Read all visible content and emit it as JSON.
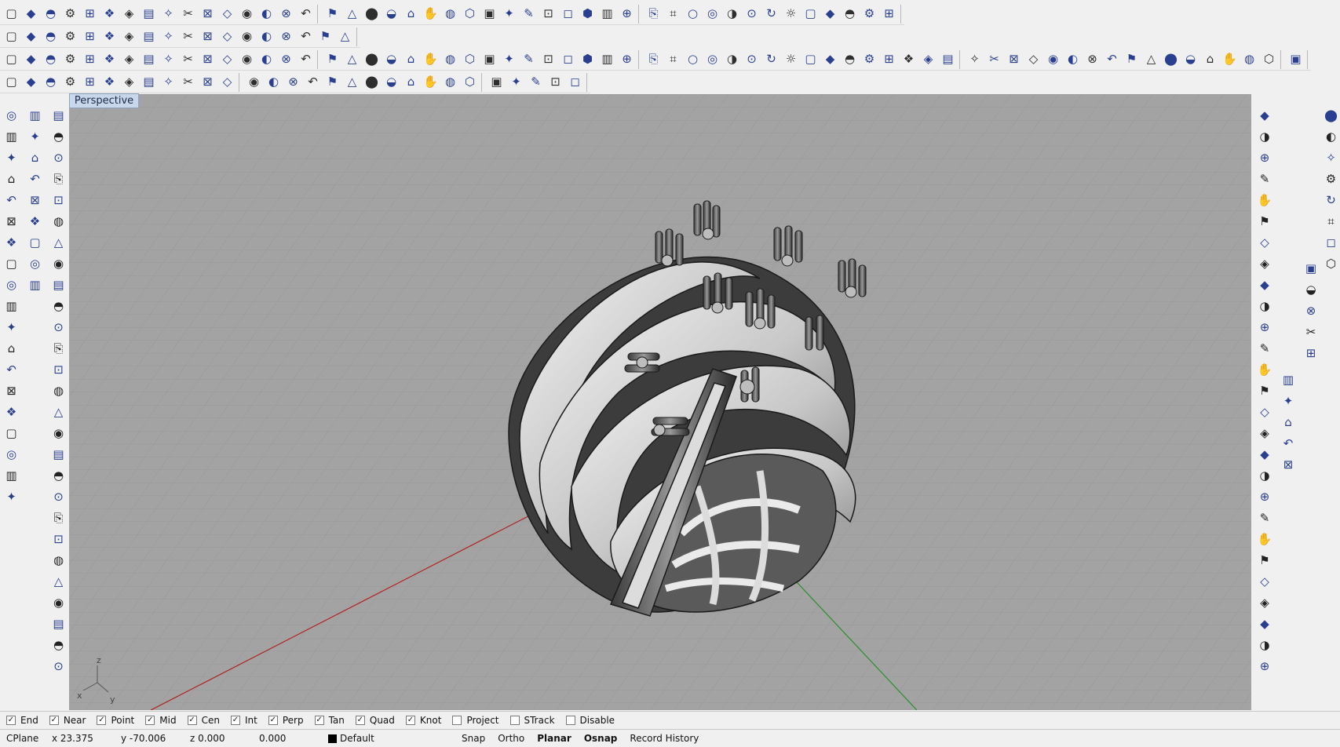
{
  "toolbars": {
    "row1": [
      "new-file",
      "open-file",
      "save-file",
      "print",
      "export",
      "cut",
      "copy",
      "paste",
      "undo",
      "pan",
      "rotate-view",
      "zoom",
      "zoom-window",
      "zoom-extents",
      "zoom-selected",
      "undo-view",
      "four-viewports",
      "car-icon",
      "cplane",
      "orientation",
      "object-snap",
      "bulb",
      "lock",
      "paint",
      "color-wheel",
      "sphere-wire",
      "sphere-grid",
      "sphere-render",
      "flag",
      "gear",
      "setup",
      "help",
      "box",
      "sphere",
      "ellipsoid",
      "paraboloid",
      "cone",
      "pyramid",
      "truncated-cone",
      "cylinder",
      "tube",
      "torus",
      "torus-half",
      "pipe",
      "surface"
    ],
    "row2": [
      "extrude-curve",
      "extrude-surface",
      "plane",
      "corner-plane",
      "box-surface",
      "loft",
      "patch",
      "network",
      "sweep1",
      "sweep2",
      "revolve",
      "rail-revolve",
      "edge-srf",
      "blend-srf",
      "points",
      "offset-srf",
      "fillet",
      "cap"
    ],
    "row3": [
      "point",
      "curve",
      "circle",
      "arc",
      "ellipse",
      "polygon",
      "rectangle",
      "line",
      "text",
      "fillet-curve",
      "chamfer",
      "extend",
      "trim",
      "split",
      "join",
      "explode",
      "group",
      "ungroup",
      "array",
      "mirror",
      "move",
      "copy-obj",
      "rotate",
      "scale",
      "orient",
      "flow",
      "twist",
      "bend",
      "taper",
      "cage",
      "boolean-union",
      "boolean-diff",
      "boolean-inter",
      "boolean-split",
      "solid-box",
      "solid-cyl",
      "solid-sphere",
      "solid-tube",
      "solid-pipe",
      "solid-fillet",
      "solid-chamfer",
      "shell",
      "wireframe",
      "shaded",
      "ghost",
      "rendered",
      "xray",
      "technical",
      "artistic",
      "pen",
      "walk",
      "fit",
      "deg",
      "sel-all",
      "sel-none",
      "gumball",
      "history",
      "record",
      "analysis",
      "curvature",
      "zebra",
      "env-map",
      "draft-angle",
      "emap",
      "deviation"
    ],
    "row4": [
      "light-off",
      "light-on",
      "light-spot",
      "light-point",
      "light-dir",
      "light-area",
      "lock-obj",
      "unlock-obj",
      "hide-obj",
      "show-obj",
      "isolate",
      "unisolate",
      "layer-off",
      "layer-on",
      "layer-lock",
      "layer-unlock",
      "layer-props",
      "render-preview",
      "render-full",
      "render-region",
      "render-batch",
      "render-sun",
      "material-a",
      "material-b",
      "material-c",
      "material-d",
      "material-e",
      "material-f",
      "material-g"
    ]
  },
  "viewport": {
    "tab_label": "Perspective",
    "axis_labels": {
      "z": "z",
      "x": "x",
      "y": "y"
    }
  },
  "osnaps": [
    {
      "label": "End",
      "checked": true
    },
    {
      "label": "Near",
      "checked": true
    },
    {
      "label": "Point",
      "checked": true
    },
    {
      "label": "Mid",
      "checked": true
    },
    {
      "label": "Cen",
      "checked": true
    },
    {
      "label": "Int",
      "checked": true
    },
    {
      "label": "Perp",
      "checked": true
    },
    {
      "label": "Tan",
      "checked": true
    },
    {
      "label": "Quad",
      "checked": true
    },
    {
      "label": "Knot",
      "checked": true
    },
    {
      "label": "Project",
      "checked": false
    },
    {
      "label": "STrack",
      "checked": false
    },
    {
      "label": "Disable",
      "checked": false
    }
  ],
  "status": {
    "cplane": "CPlane",
    "x": "x 23.375",
    "y": "y -70.006",
    "z": "z 0.000",
    "extra": "0.000",
    "layer": "Default",
    "snap": "Snap",
    "ortho": "Ortho",
    "planar": "Planar",
    "osnap": "Osnap",
    "record_history": "Record History"
  },
  "colors": {
    "viewport_bg": "#a3a3a3",
    "grid_line": "#959595",
    "x_axis": "#b02020",
    "y_axis": "#2a8f2a",
    "tab_bg": "#c9d7ea"
  }
}
